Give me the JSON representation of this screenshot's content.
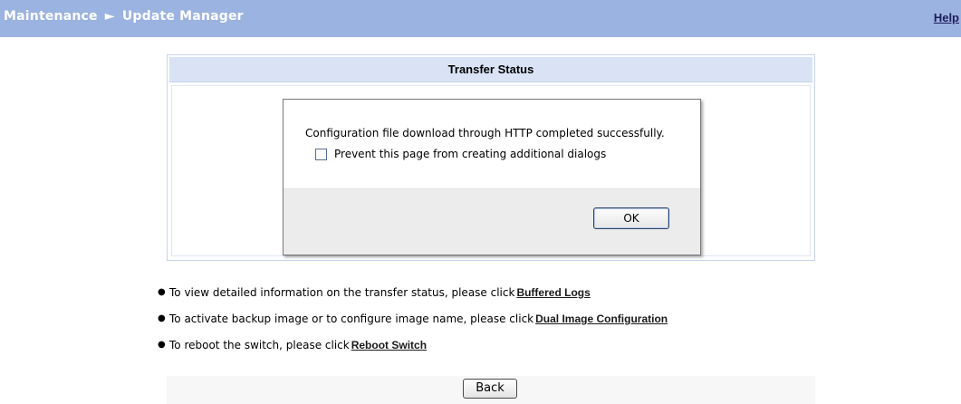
{
  "header": {
    "section": "Maintenance",
    "separator": "►",
    "page": "Update Manager",
    "help_label": "Help"
  },
  "panel": {
    "title": "Transfer Status"
  },
  "dialog": {
    "message": "Configuration file download through HTTP completed successfully.",
    "checkbox_label": "Prevent this page from creating additional dialogs",
    "checkbox_checked": false,
    "ok_label": "OK"
  },
  "info": {
    "bullet": "●",
    "items": [
      {
        "text": "To view detailed information on the transfer status, please click",
        "link": "Buffered Logs"
      },
      {
        "text": "To activate backup image or to configure image name, please click",
        "link": "Dual Image Configuration"
      },
      {
        "text": "To reboot the switch, please click",
        "link": "Reboot Switch"
      }
    ]
  },
  "back_label": "Back"
}
